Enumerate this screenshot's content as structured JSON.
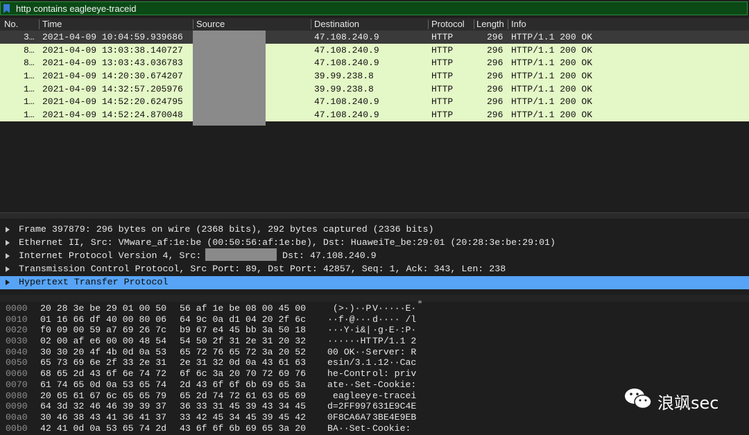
{
  "filter": {
    "text": "http contains eagleeye-traceid"
  },
  "columns": [
    "No.",
    "Time",
    "Source",
    "Destination",
    "Protocol",
    "Length",
    "Info"
  ],
  "packets": [
    {
      "no": "3…",
      "time": "2021-04-09 10:04:59.939686",
      "destination": "47.108.240.9",
      "protocol": "HTTP",
      "length": "296",
      "info": "HTTP/1.1 200 OK"
    },
    {
      "no": "8…",
      "time": "2021-04-09 13:03:38.140727",
      "destination": "47.108.240.9",
      "protocol": "HTTP",
      "length": "296",
      "info": "HTTP/1.1 200 OK"
    },
    {
      "no": "8…",
      "time": "2021-04-09 13:03:43.036783",
      "destination": "47.108.240.9",
      "protocol": "HTTP",
      "length": "296",
      "info": "HTTP/1.1 200 OK"
    },
    {
      "no": "1…",
      "time": "2021-04-09 14:20:30.674207",
      "destination": "39.99.238.8",
      "protocol": "HTTP",
      "length": "296",
      "info": "HTTP/1.1 200 OK"
    },
    {
      "no": "1…",
      "time": "2021-04-09 14:32:57.205976",
      "destination": "39.99.238.8",
      "protocol": "HTTP",
      "length": "296",
      "info": "HTTP/1.1 200 OK"
    },
    {
      "no": "1…",
      "time": "2021-04-09 14:52:20.624795",
      "destination": "47.108.240.9",
      "protocol": "HTTP",
      "length": "296",
      "info": "HTTP/1.1 200 OK"
    },
    {
      "no": "1…",
      "time": "2021-04-09 14:52:24.870048",
      "destination": "47.108.240.9",
      "protocol": "HTTP",
      "length": "296",
      "info": "HTTP/1.1 200 OK"
    }
  ],
  "details": [
    "Frame 397879: 296 bytes on wire (2368 bits), 292 bytes captured (2336 bits)",
    "Ethernet II, Src: VMware_af:1e:be (00:50:56:af:1e:be), Dst: HuaweiTe_be:29:01 (20:28:3e:be:29:01)",
    "Internet Protocol Version 4, Src:",
    "Dst: 47.108.240.9",
    "Transmission Control Protocol, Src Port: 89, Dst Port: 42857, Seq: 1, Ack: 343, Len: 238",
    "Hypertext Transfer Protocol"
  ],
  "hex": [
    {
      "off": "0000",
      "b1": "20 28 3e be 29 01 00 50",
      "b2": "56 af 1e be 08 00 45 00",
      "a1": " (>·)··P",
      "a2": "V·····E·"
    },
    {
      "off": "0010",
      "b1": "01 16 66 df 40 00 80 06",
      "b2": "64 9c 0a d1 04 20 2f 6c",
      "a1": "··f·@···",
      "a2": "d···· /l"
    },
    {
      "off": "0020",
      "b1": "f0 09 00 59 a7 69 26 7c",
      "b2": "b9 67 e4 45 bb 3a 50 18",
      "a1": "···Y·i&|",
      "a2": "·g·E·:P·"
    },
    {
      "off": "0030",
      "b1": "02 00 af e6 00 00 48 54",
      "b2": "54 50 2f 31 2e 31 20 32",
      "a1": "······HT",
      "a2": "TP/1.1 2"
    },
    {
      "off": "0040",
      "b1": "30 30 20 4f 4b 0d 0a 53",
      "b2": "65 72 76 65 72 3a 20 52",
      "a1": "00 OK··S",
      "a2": "erver: R"
    },
    {
      "off": "0050",
      "b1": "65 73 69 6e 2f 33 2e 31",
      "b2": "2e 31 32 0d 0a 43 61 63",
      "a1": "esin/3.1",
      "a2": ".12··Cac"
    },
    {
      "off": "0060",
      "b1": "68 65 2d 43 6f 6e 74 72",
      "b2": "6f 6c 3a 20 70 72 69 76",
      "a1": "he-Contr",
      "a2": "ol: priv"
    },
    {
      "off": "0070",
      "b1": "61 74 65 0d 0a 53 65 74",
      "b2": "2d 43 6f 6f 6b 69 65 3a",
      "a1": "ate··Set",
      "a2": "-Cookie:"
    },
    {
      "off": "0080",
      "b1": "20 65 61 67 6c 65 65 79",
      "b2": "65 2d 74 72 61 63 65 69",
      "a1": " eagleey",
      "a2": "e-tracei"
    },
    {
      "off": "0090",
      "b1": "64 3d 32 46 46 39 39 37",
      "b2": "36 33 31 45 39 43 34 45",
      "a1": "d=2FF997",
      "a2": "631E9C4E"
    },
    {
      "off": "00a0",
      "b1": "30 46 38 43 41 36 41 37",
      "b2": "33 42 45 34 45 39 45 42",
      "a1": "0F8CA6A7",
      "a2": "3BE4E9EB"
    },
    {
      "off": "00b0",
      "b1": "42 41 0d 0a 53 65 74 2d",
      "b2": "43 6f 6f 6b 69 65 3a 20",
      "a1": "BA··Set-",
      "a2": "Cookie: "
    }
  ],
  "watermark": {
    "text": "浪飒sec",
    "icon": "wechat-icon"
  }
}
